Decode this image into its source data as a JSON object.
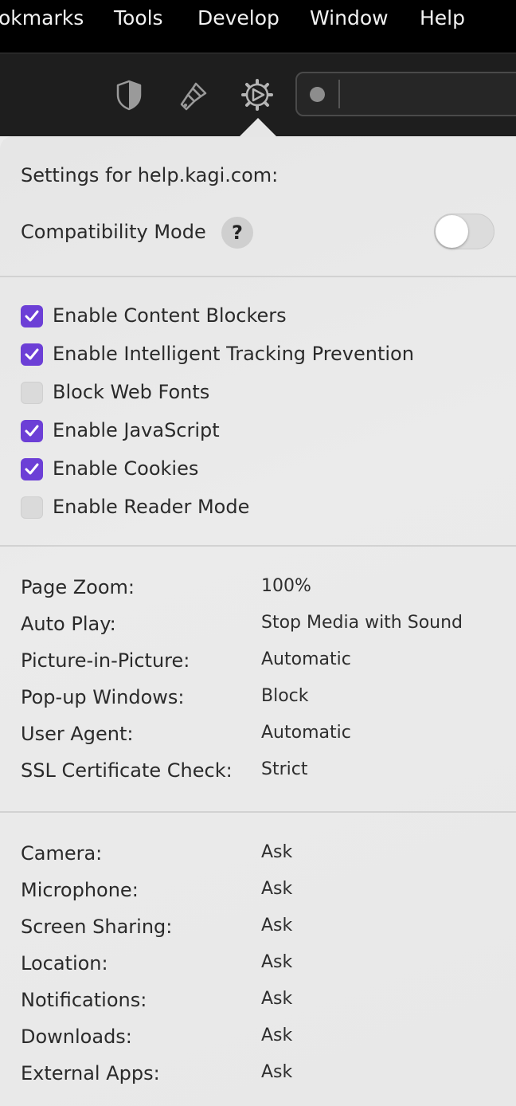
{
  "menubar": {
    "items": [
      "okmarks",
      "Tools",
      "Develop",
      "Window",
      "Help"
    ]
  },
  "toolbar": {
    "icons": [
      "shield-icon",
      "brush-icon",
      "gear-icon"
    ]
  },
  "popover": {
    "title": "Settings for help.kagi.com:",
    "compat_label": "Compatibility Mode",
    "help_label": "?",
    "compat_on": false,
    "checkboxes": [
      {
        "label": "Enable Content Blockers",
        "checked": true
      },
      {
        "label": "Enable Intelligent Tracking Prevention",
        "checked": true
      },
      {
        "label": "Block Web Fonts",
        "checked": false
      },
      {
        "label": "Enable JavaScript",
        "checked": true
      },
      {
        "label": "Enable Cookies",
        "checked": true
      },
      {
        "label": "Enable Reader Mode",
        "checked": false
      }
    ],
    "settings": [
      {
        "label": "Page Zoom:",
        "value": "100%"
      },
      {
        "label": "Auto Play:",
        "value": "Stop Media with Sound"
      },
      {
        "label": "Picture-in-Picture:",
        "value": "Automatic"
      },
      {
        "label": "Pop-up Windows:",
        "value": "Block"
      },
      {
        "label": "User Agent:",
        "value": "Automatic"
      },
      {
        "label": "SSL Certificate Check:",
        "value": "Strict"
      }
    ],
    "permissions": [
      {
        "label": "Camera:",
        "value": "Ask"
      },
      {
        "label": "Microphone:",
        "value": "Ask"
      },
      {
        "label": "Screen Sharing:",
        "value": "Ask"
      },
      {
        "label": "Location:",
        "value": "Ask"
      },
      {
        "label": "Notifications:",
        "value": "Ask"
      },
      {
        "label": "Downloads:",
        "value": "Ask"
      },
      {
        "label": "External Apps:",
        "value": "Ask"
      }
    ],
    "accent_color": "#6c3fd6"
  }
}
